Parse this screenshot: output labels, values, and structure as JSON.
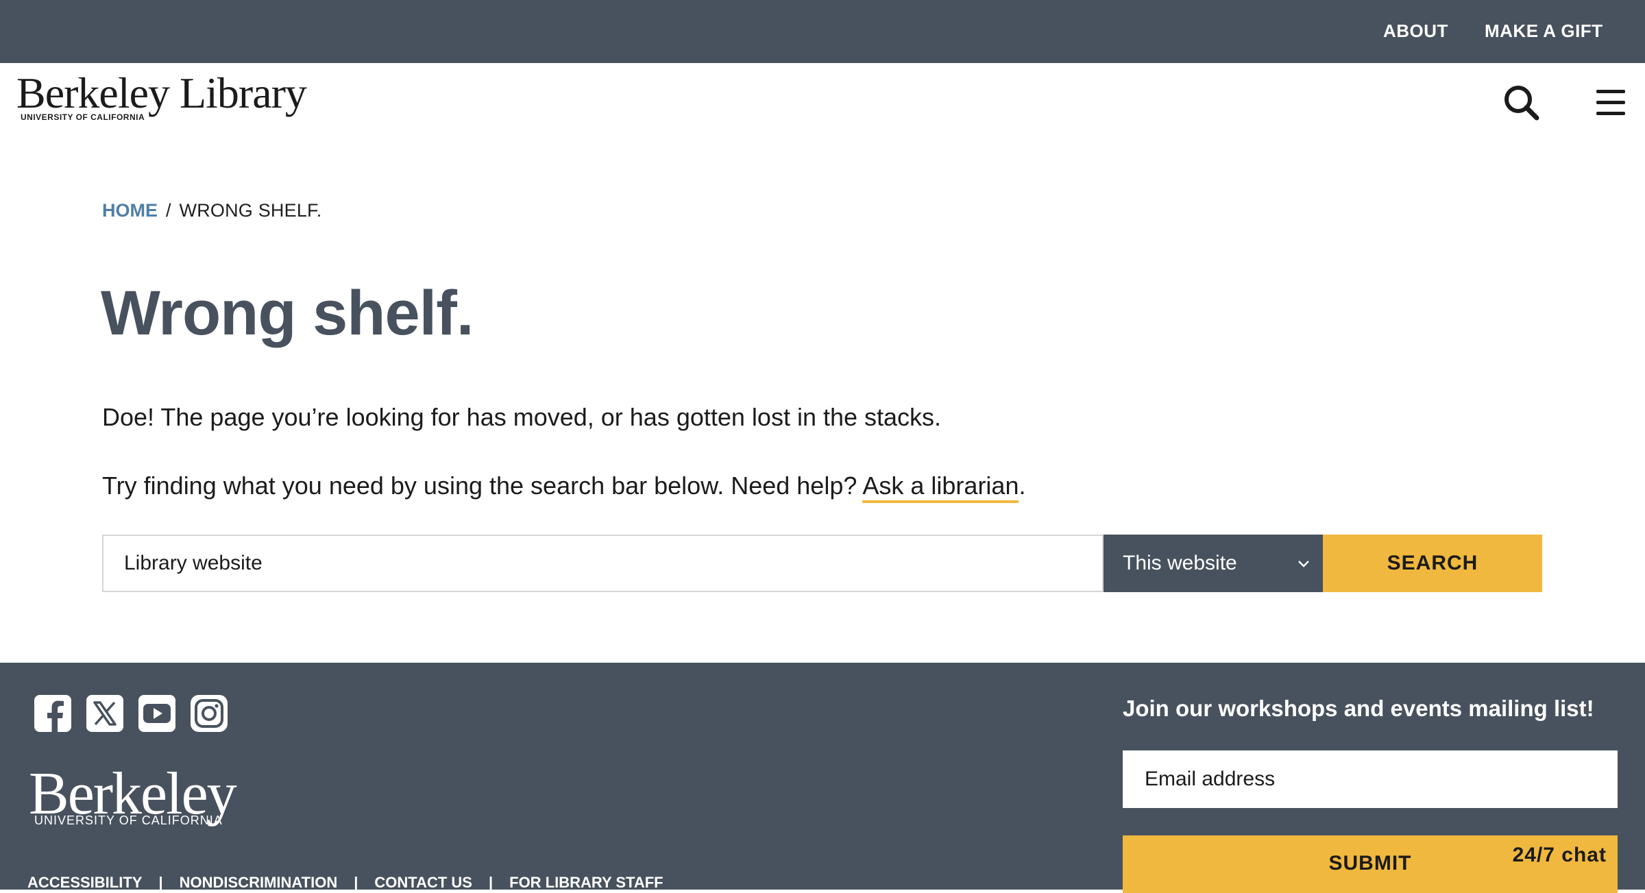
{
  "utility_nav": {
    "about": "ABOUT",
    "make_gift": "MAKE A GIFT"
  },
  "header": {
    "logo_wordmark": "Berkeley Library",
    "logo_subtitle": "UNIVERSITY OF CALIFORNIA",
    "search_icon": "search-icon",
    "menu_icon": "hamburger-menu-icon"
  },
  "breadcrumb": {
    "home": "HOME",
    "separator": "/",
    "current": "WRONG SHELF."
  },
  "main": {
    "title": "Wrong shelf.",
    "message": "Doe! The page you’re looking for has moved, or has gotten lost in the stacks.",
    "help_prefix": "Try finding what you need by using the search bar below. Need help?",
    "help_link": "Ask a librarian",
    "help_suffix": "."
  },
  "search": {
    "placeholder": "Library website",
    "scope_selected": "This website",
    "button_label": "SEARCH"
  },
  "footer": {
    "social_icons": [
      "facebook-icon",
      "x-twitter-icon",
      "youtube-icon",
      "instagram-icon"
    ],
    "logo_wordmark": "Berkeley",
    "logo_subtitle": "UNIVERSITY OF CALIFORNIA",
    "links": [
      "ACCESSIBILITY",
      "NONDISCRIMINATION",
      "CONTACT US",
      "FOR LIBRARY STAFF"
    ],
    "link_divider": "|",
    "mailing_heading": "Join our workshops and events mailing list!",
    "email_placeholder": "Email address",
    "submit_label": "SUBMIT",
    "chat_label": "24/7 chat"
  },
  "colors": {
    "slate": "#48525e",
    "gold": "#f0b83e",
    "link_blue": "#4f7fa6"
  }
}
